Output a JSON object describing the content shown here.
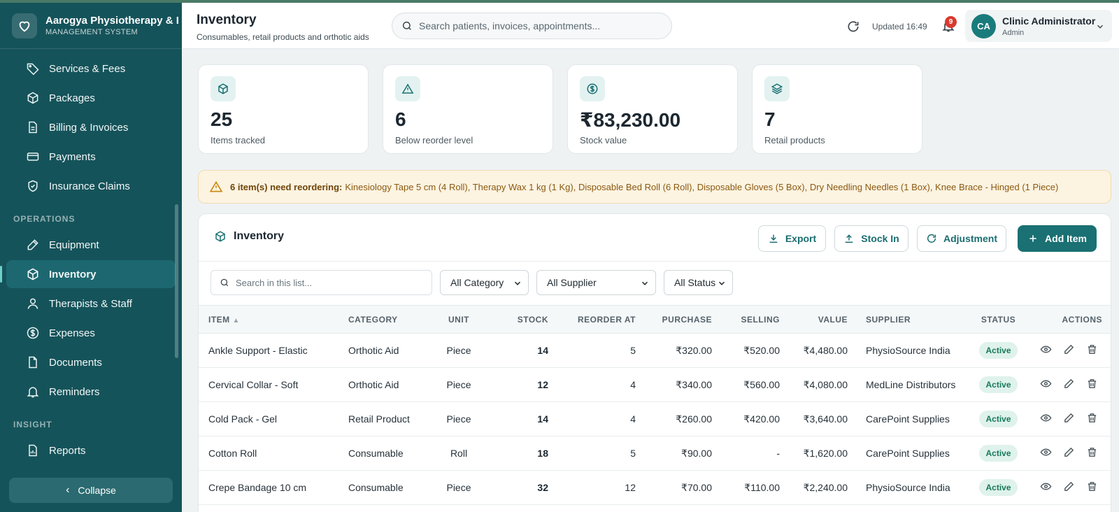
{
  "app": {
    "brand_name": "Aarogya Physiotherapy & I",
    "brand_sub": "MANAGEMENT SYSTEM"
  },
  "sidebar": {
    "items_top": [
      {
        "label": "Services & Fees",
        "icon": "tag-icon"
      },
      {
        "label": "Packages",
        "icon": "package-icon"
      },
      {
        "label": "Billing & Invoices",
        "icon": "document-icon"
      },
      {
        "label": "Payments",
        "icon": "credit-card-icon"
      },
      {
        "label": "Insurance Claims",
        "icon": "shield-icon"
      }
    ],
    "section_operations": "OPERATIONS",
    "items_ops": [
      {
        "label": "Equipment",
        "icon": "wrench-icon"
      },
      {
        "label": "Inventory",
        "icon": "box-icon"
      },
      {
        "label": "Therapists & Staff",
        "icon": "user-icon"
      },
      {
        "label": "Expenses",
        "icon": "dollar-circle-icon"
      },
      {
        "label": "Documents",
        "icon": "file-icon"
      },
      {
        "label": "Reminders",
        "icon": "bell-icon"
      }
    ],
    "section_insight": "INSIGHT",
    "items_insight": [
      {
        "label": "Reports",
        "icon": "chart-file-icon"
      }
    ],
    "collapse_label": "Collapse"
  },
  "header": {
    "title": "Inventory",
    "subtitle": "Consumables, retail products and orthotic aids",
    "search_placeholder": "Search patients, invoices, appointments...",
    "updated": "Updated 16:49",
    "notification_count": "9",
    "user_initials": "CA",
    "user_name": "Clinic Administrator",
    "user_role": "Admin"
  },
  "stats": [
    {
      "value": "25",
      "label": "Items tracked",
      "icon": "box-icon"
    },
    {
      "value": "6",
      "label": "Below reorder level",
      "icon": "warning-icon"
    },
    {
      "value": "₹83,230.00",
      "label": "Stock value",
      "icon": "dollar-circle-icon"
    },
    {
      "value": "7",
      "label": "Retail products",
      "icon": "layers-icon"
    }
  ],
  "alert": {
    "strong": "6 item(s) need reordering:",
    "text": "Kinesiology Tape 5 cm (4 Roll), Therapy Wax 1 kg (1 Kg), Disposable Bed Roll (6 Roll), Disposable Gloves (5 Box), Dry Needling Needles (1 Box), Knee Brace - Hinged (1 Piece)"
  },
  "panel": {
    "title": "Inventory",
    "export": "Export",
    "stock_in": "Stock In",
    "adjustment": "Adjustment",
    "add_item": "Add Item",
    "list_search_placeholder": "Search in this list...",
    "filter_category": "All Category",
    "filter_supplier": "All Supplier",
    "filter_status": "All Status"
  },
  "table": {
    "columns": [
      "ITEM",
      "CATEGORY",
      "UNIT",
      "STOCK",
      "REORDER AT",
      "PURCHASE",
      "SELLING",
      "VALUE",
      "SUPPLIER",
      "STATUS",
      "ACTIONS"
    ],
    "sort_indicator": "▲",
    "rows": [
      {
        "item": "Ankle Support - Elastic",
        "category": "Orthotic Aid",
        "unit": "Piece",
        "stock": "14",
        "reorder": "5",
        "purchase": "₹320.00",
        "selling": "₹520.00",
        "value": "₹4,480.00",
        "supplier": "PhysioSource India",
        "status": "Active"
      },
      {
        "item": "Cervical Collar - Soft",
        "category": "Orthotic Aid",
        "unit": "Piece",
        "stock": "12",
        "reorder": "4",
        "purchase": "₹340.00",
        "selling": "₹560.00",
        "value": "₹4,080.00",
        "supplier": "MedLine Distributors",
        "status": "Active"
      },
      {
        "item": "Cold Pack - Gel",
        "category": "Retail Product",
        "unit": "Piece",
        "stock": "14",
        "reorder": "4",
        "purchase": "₹260.00",
        "selling": "₹420.00",
        "value": "₹3,640.00",
        "supplier": "CarePoint Supplies",
        "status": "Active"
      },
      {
        "item": "Cotton Roll",
        "category": "Consumable",
        "unit": "Roll",
        "stock": "18",
        "reorder": "5",
        "purchase": "₹90.00",
        "selling": "-",
        "value": "₹1,620.00",
        "supplier": "CarePoint Supplies",
        "status": "Active"
      },
      {
        "item": "Crepe Bandage 10 cm",
        "category": "Consumable",
        "unit": "Piece",
        "stock": "32",
        "reorder": "12",
        "purchase": "₹70.00",
        "selling": "₹110.00",
        "value": "₹2,240.00",
        "supplier": "PhysioSource India",
        "status": "Active"
      }
    ]
  },
  "colors": {
    "sidebar_bg": "#15535a",
    "accent": "#1a7073",
    "status_active_bg": "#dff2ec",
    "status_active_text": "#18795a",
    "alert_bg": "#fdf3e1",
    "badge_red": "#d93a2f"
  }
}
